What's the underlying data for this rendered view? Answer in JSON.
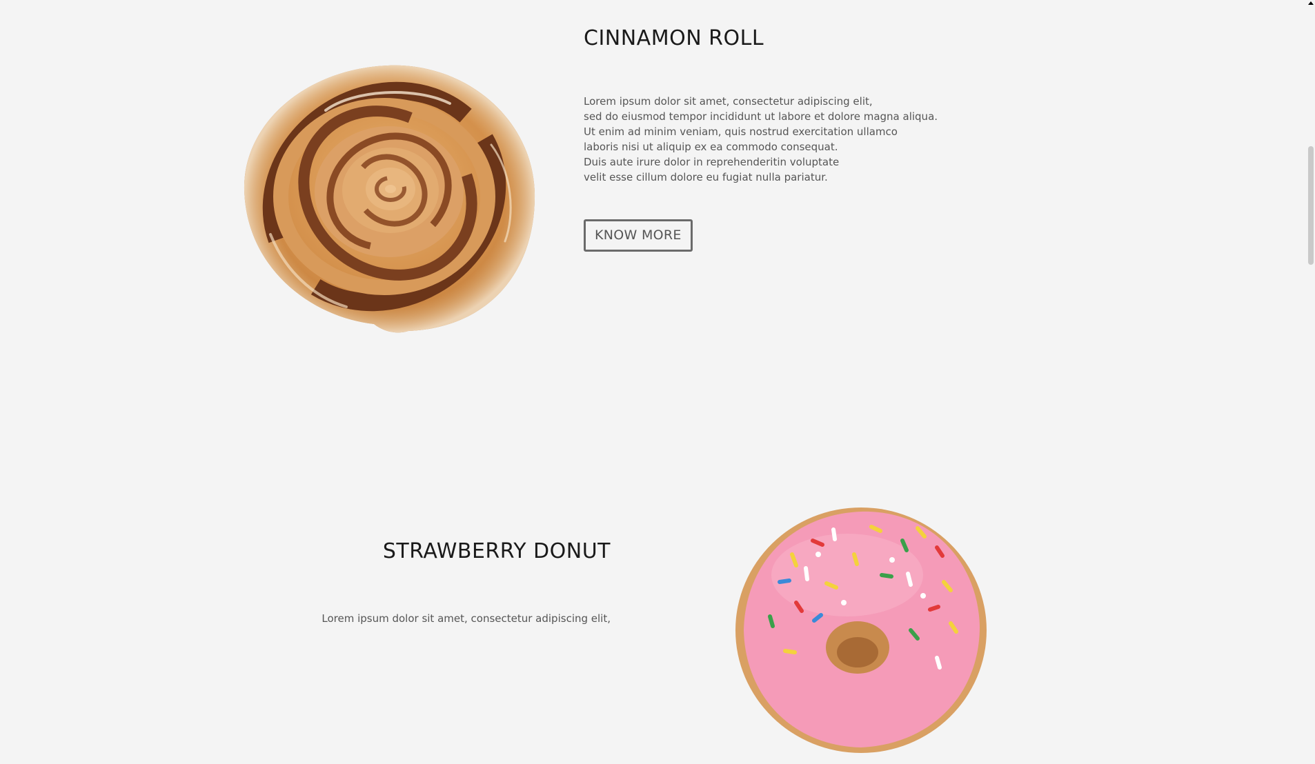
{
  "products": [
    {
      "title": "CINNAMON ROLL",
      "description_lines": [
        "Lorem ipsum dolor sit amet, consectetur adipiscing elit,",
        "sed do eiusmod tempor incididunt ut labore et dolore magna aliqua.",
        "Ut enim ad minim veniam, quis nostrud exercitation ullamco",
        "laboris nisi ut aliquip ex ea commodo consequat.",
        "Duis aute irure dolor in reprehenderitin voluptate",
        "velit esse cillum dolore eu fugiat nulla pariatur."
      ],
      "button_label": "KNOW MORE",
      "image_icon": "cinnamon-roll-image"
    },
    {
      "title": "STRAWBERRY DONUT",
      "description_lines": [
        "Lorem ipsum dolor sit amet, consectetur adipiscing elit,"
      ],
      "image_icon": "strawberry-donut-image"
    }
  ],
  "colors": {
    "background": "#f4f4f4",
    "title": "#1a1a1a",
    "body_text": "#555555",
    "button_border": "#6a6a6a",
    "donut_frosting": "#f59bb8",
    "roll_dough": "#d4914c",
    "roll_cinnamon": "#6b3519"
  }
}
